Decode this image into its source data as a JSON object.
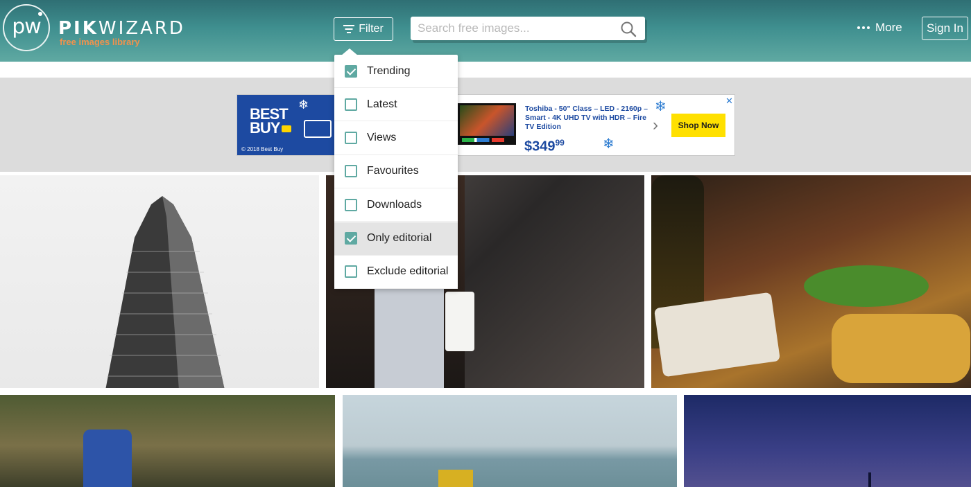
{
  "header": {
    "logo_mark": "pw",
    "brand_name_bold": "PIK",
    "brand_name_light": "WIZARD",
    "tagline": "free images library",
    "filter_label": "Filter",
    "search_placeholder": "Search free images...",
    "more_label": "More",
    "signin_label": "Sign In"
  },
  "filter_menu": {
    "items": [
      {
        "label": "Trending",
        "checked": true
      },
      {
        "label": "Latest",
        "checked": false
      },
      {
        "label": "Views",
        "checked": false
      },
      {
        "label": "Favourites",
        "checked": false
      },
      {
        "label": "Downloads",
        "checked": false
      },
      {
        "label": "Only editorial",
        "checked": true
      },
      {
        "label": "Exclude editorial",
        "checked": false
      }
    ]
  },
  "ad": {
    "brand_line1": "BEST",
    "brand_line2": "BUY",
    "copyright": "© 2018 Best Buy",
    "product": "Toshiba - 50\" Class – LED - 2160p – Smart - 4K UHD TV with HDR – Fire TV Edition",
    "price_main": "$349",
    "price_cents": "99",
    "cta": "Shop Now",
    "close": "✕"
  },
  "photos": [
    {
      "name": "flatiron-building"
    },
    {
      "name": "woman-coffee-car"
    },
    {
      "name": "food-platter-beer"
    },
    {
      "name": "dirt-bike-rider"
    },
    {
      "name": "beach-tractor"
    },
    {
      "name": "city-night-sky"
    }
  ],
  "icons": {
    "filter": "filter-lines-icon",
    "search": "magnifier-icon",
    "more": "three-dots-icon",
    "checkbox": "checkbox-icon"
  },
  "colors": {
    "header_top": "#2f6f74",
    "header_bottom": "#5fa9a2",
    "tagline": "#f0924d",
    "accent": "#5fa9a2",
    "ad_blue": "#1d4aa1",
    "ad_yellow": "#ffe000"
  }
}
